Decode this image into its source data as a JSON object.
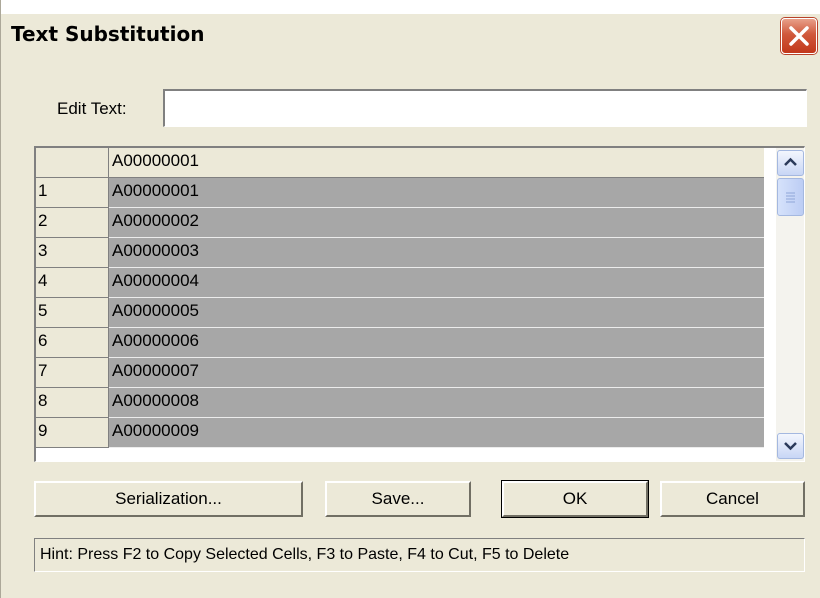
{
  "window": {
    "title": "Text Substitution"
  },
  "edit": {
    "label": "Edit Text:",
    "value": "",
    "placeholder": ""
  },
  "grid": {
    "header": {
      "num": "",
      "value": "A00000001"
    },
    "rows": [
      {
        "num": "1",
        "value": "A00000001"
      },
      {
        "num": "2",
        "value": "A00000002"
      },
      {
        "num": "3",
        "value": "A00000003"
      },
      {
        "num": "4",
        "value": "A00000004"
      },
      {
        "num": "5",
        "value": "A00000005"
      },
      {
        "num": "6",
        "value": "A00000006"
      },
      {
        "num": "7",
        "value": "A00000007"
      },
      {
        "num": "8",
        "value": "A00000008"
      },
      {
        "num": "9",
        "value": "A00000009"
      }
    ]
  },
  "buttons": {
    "serialization": "Serialization...",
    "save": "Save...",
    "ok": "OK",
    "cancel": "Cancel"
  },
  "hint": "Hint: Press F2 to Copy Selected Cells, F3 to Paste, F4 to Cut, F5 to Delete",
  "icons": {
    "close": "close-icon",
    "scroll_up": "chevron-up-icon",
    "scroll_down": "chevron-down-icon"
  },
  "colors": {
    "dialog_bg": "#ece9d8",
    "selected_cell": "#a7a7a7",
    "close_button": "#d0593c"
  }
}
